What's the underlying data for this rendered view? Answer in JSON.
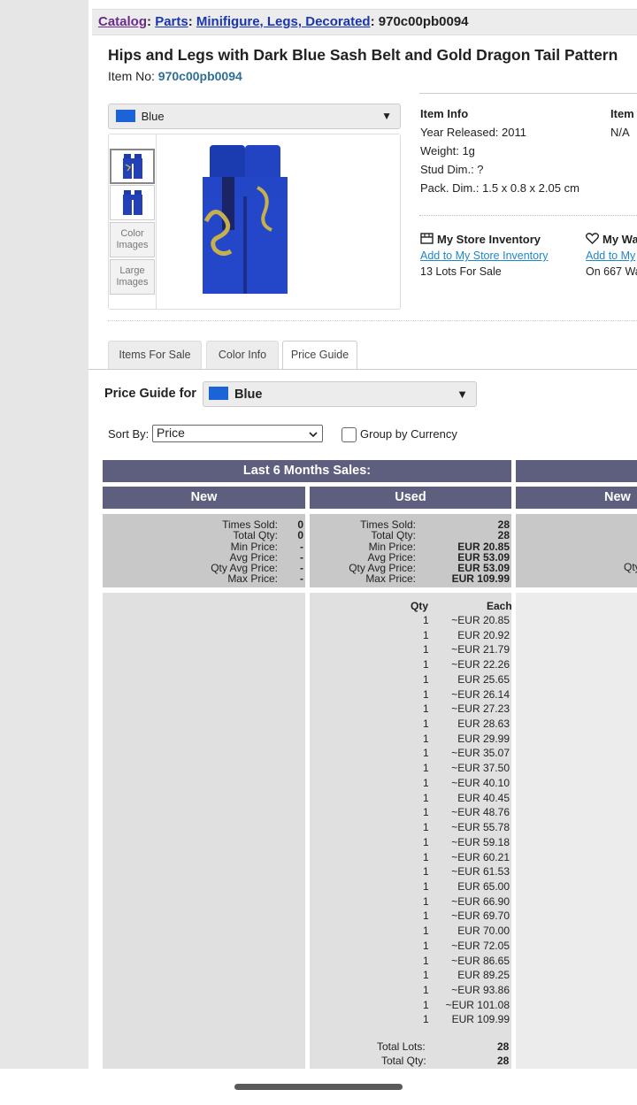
{
  "breadcrumb": {
    "catalog": "Catalog",
    "sep1": ":",
    "parts": "Parts",
    "sep2": ":",
    "category": "Minifigure, Legs, Decorated",
    "sep3": ":",
    "item": "970c00pb0094"
  },
  "item": {
    "title": "Hips and Legs with Dark Blue Sash Belt and Gold Dragon Tail Pattern",
    "number_label": "Item No:",
    "number": "970c00pb0094"
  },
  "color_select": {
    "value": "Blue",
    "swatch_color": "#1b63d6"
  },
  "thumbnails": {
    "color_images": "Color Images",
    "large_images": "Large Images"
  },
  "item_info": {
    "heading": "Item Info",
    "year": "Year Released: 2011",
    "weight": "Weight: 1g",
    "stud": "Stud Dim.: ?",
    "pack": "Pack. Dim.: 1.5 x 0.8 x 2.05 cm"
  },
  "item_info2": {
    "heading": "Item",
    "value": "N/A"
  },
  "store": {
    "heading": "My Store Inventory",
    "link": "Add to My Store Inventory",
    "lots": "13 Lots For Sale"
  },
  "wanted": {
    "heading": "My Wa",
    "link": "Add to My",
    "count": "On 667 Wa"
  },
  "tabs": [
    "Items For Sale",
    "Color Info",
    "Price Guide"
  ],
  "price_guide": {
    "label": "Price Guide for",
    "color": "Blue",
    "sort_label": "Sort By:",
    "sort_value": "Price",
    "group_label": "Group by Currency"
  },
  "sales": {
    "header": "Last 6 Months Sales:",
    "new_label": "New",
    "used_label": "Used",
    "new_right_label": "New",
    "stat_labels": [
      "Times Sold:",
      "Total Qty:",
      "Min Price:",
      "Avg Price:",
      "Qty Avg Price:",
      "Max Price:"
    ],
    "new_stats": [
      "0",
      "0",
      "-",
      "-",
      "-",
      "-"
    ],
    "used_stats": [
      "28",
      "28",
      "EUR 20.85",
      "EUR 53.09",
      "EUR 53.09",
      "EUR 109.99"
    ],
    "partial_label": "Qty",
    "list_qty_header": "Qty",
    "list_each_header": "Each",
    "rows": [
      [
        "1",
        "~EUR 20.85"
      ],
      [
        "1",
        "EUR 20.92"
      ],
      [
        "1",
        "~EUR 21.79"
      ],
      [
        "1",
        "~EUR 22.26"
      ],
      [
        "1",
        "EUR 25.65"
      ],
      [
        "1",
        "~EUR 26.14"
      ],
      [
        "1",
        "~EUR 27.23"
      ],
      [
        "1",
        "EUR 28.63"
      ],
      [
        "1",
        "EUR 29.99"
      ],
      [
        "1",
        "~EUR 35.07"
      ],
      [
        "1",
        "~EUR 37.50"
      ],
      [
        "1",
        "~EUR 40.10"
      ],
      [
        "1",
        "EUR 40.45"
      ],
      [
        "1",
        "~EUR 48.76"
      ],
      [
        "1",
        "~EUR 55.78"
      ],
      [
        "1",
        "~EUR 59.18"
      ],
      [
        "1",
        "~EUR 60.21"
      ],
      [
        "1",
        "~EUR 61.53"
      ],
      [
        "1",
        "EUR 65.00"
      ],
      [
        "1",
        "~EUR 66.90"
      ],
      [
        "1",
        "~EUR 69.70"
      ],
      [
        "1",
        "EUR 70.00"
      ],
      [
        "1",
        "~EUR 72.05"
      ],
      [
        "1",
        "~EUR 86.65"
      ],
      [
        "1",
        "EUR 89.25"
      ],
      [
        "1",
        "~EUR 93.86"
      ],
      [
        "1",
        "~EUR 101.08"
      ],
      [
        "1",
        "EUR 109.99"
      ]
    ],
    "total_lots_label": "Total Lots:",
    "total_lots": "28",
    "total_qty_label": "Total Qty:",
    "total_qty": "28"
  }
}
